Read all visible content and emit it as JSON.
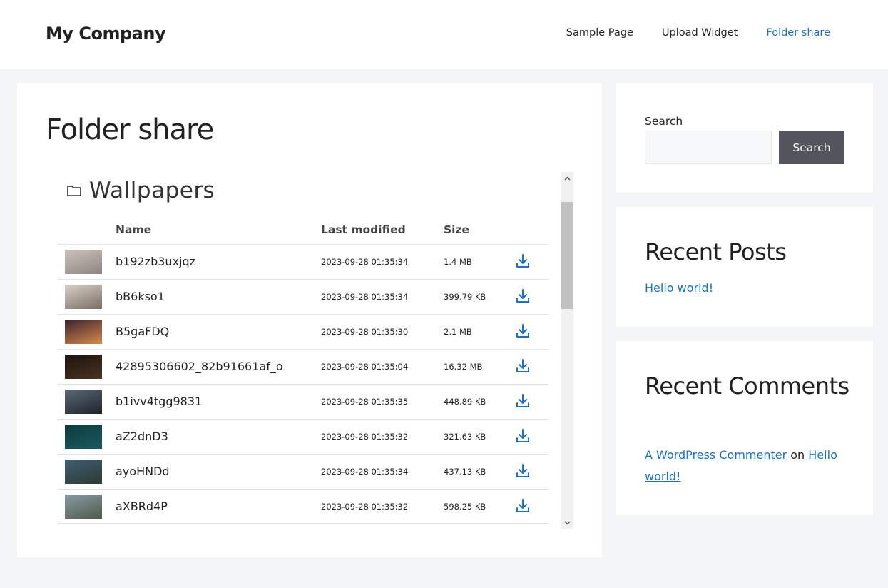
{
  "header": {
    "site_title": "My Company",
    "nav": [
      {
        "label": "Sample Page"
      },
      {
        "label": "Upload Widget"
      },
      {
        "label": "Folder share"
      }
    ],
    "accent_color": "#1e72bd"
  },
  "main": {
    "page_title": "Folder share",
    "folder": {
      "icon": "folder-icon",
      "name": "Wallpapers",
      "columns": {
        "name": "Name",
        "modified": "Last modified",
        "size": "Size"
      },
      "files": [
        {
          "name": "b192zb3uxjqz",
          "modified": "2023-09-28 01:35:34",
          "size": "1.4 MB",
          "thumb_colors": [
            "#c9c2bd",
            "#8f8580"
          ]
        },
        {
          "name": "bB6kso1",
          "modified": "2023-09-28 01:35:34",
          "size": "399.79 KB",
          "thumb_colors": [
            "#d8d0c8",
            "#7a6e66"
          ]
        },
        {
          "name": "B5gaFDQ",
          "modified": "2023-09-28 01:35:30",
          "size": "2.1 MB",
          "thumb_colors": [
            "#3a2230",
            "#d9894a"
          ]
        },
        {
          "name": "42895306602_82b91661af_o",
          "modified": "2023-09-28 01:35:04",
          "size": "16.32 MB",
          "thumb_colors": [
            "#1c140e",
            "#4a3220"
          ]
        },
        {
          "name": "b1ivv4tgg9831",
          "modified": "2023-09-28 01:35:35",
          "size": "448.89 KB",
          "thumb_colors": [
            "#5a6a78",
            "#1e2228"
          ]
        },
        {
          "name": "aZ2dnD3",
          "modified": "2023-09-28 01:35:32",
          "size": "321.63 KB",
          "thumb_colors": [
            "#0d3b40",
            "#1a5a5e"
          ]
        },
        {
          "name": "ayoHNDd",
          "modified": "2023-09-28 01:35:34",
          "size": "437.13 KB",
          "thumb_colors": [
            "#3e5e74",
            "#2c3a30"
          ]
        },
        {
          "name": "aXBRd4P",
          "modified": "2023-09-28 01:35:32",
          "size": "598.25 KB",
          "thumb_colors": [
            "#8a9aa8",
            "#4e5a48"
          ]
        }
      ],
      "download_icon": "download-icon"
    }
  },
  "sidebar": {
    "search": {
      "label": "Search",
      "value": "",
      "button_label": "Search"
    },
    "recent_posts": {
      "title": "Recent Posts",
      "items": [
        {
          "label": "Hello world!"
        }
      ]
    },
    "recent_comments": {
      "title": "Recent Comments",
      "items": [
        {
          "author": "A WordPress Commenter",
          "connector": "on",
          "post": "Hello world!"
        }
      ]
    }
  }
}
